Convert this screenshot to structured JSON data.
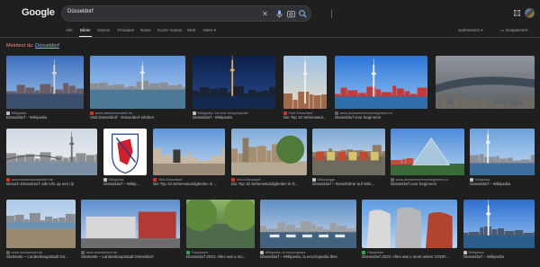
{
  "header": {
    "logo": "Google",
    "query": "Düsseldorf"
  },
  "tabs": [
    {
      "label": "Alle",
      "active": false
    },
    {
      "label": "Bilder",
      "active": true
    },
    {
      "label": "Videos",
      "active": false
    },
    {
      "label": "Produkte",
      "active": false
    },
    {
      "label": "News",
      "active": false
    },
    {
      "label": "Kurze Videos",
      "active": false
    },
    {
      "label": "Web",
      "active": false
    },
    {
      "label": "Mehr",
      "active": false
    }
  ],
  "tools": {
    "safesearch": "SafeSearch",
    "saved": "Gespeichert"
  },
  "suggestion": {
    "prefix": "Meintest du:",
    "term": "Düsseldorf"
  },
  "results": [
    {
      "source": "Wikipedia",
      "title": "Düsseldorf – Wikipedia",
      "scene": "skyline_sunset",
      "fav": "#bdc1c6"
    },
    {
      "source": "www.visitduesseldorf.de",
      "title": "Visit Düsseldorf - Düsseldorf erleben",
      "scene": "skyline_day",
      "fav": "#d93025"
    },
    {
      "source": "Wikipedia, the free encyclopedia",
      "title": "Düsseldorf - Wikipedia",
      "scene": "tower_night",
      "fav": "#bdc1c6"
    },
    {
      "source": "Visit Düsseldorf",
      "title": "Die Top 10 Sehenswür...",
      "scene": "tower_close",
      "fav": "#d93025"
    },
    {
      "source": "www.duesseldorfvoorbeginners.nl",
      "title": "Düsseldorf voor beginners",
      "scene": "skyline_blue",
      "fav": "#5f6368"
    },
    {
      "source": "",
      "title": "",
      "scene": "aerial",
      "fav": "#5f6368"
    },
    {
      "source": "www.beusteduesseldorf.de",
      "title": "Besuch Düsseldorf: alle info op een rij!",
      "scene": "bridge_river",
      "fav": "#d93025"
    },
    {
      "source": "Wikipedia",
      "title": "Düsseldorf – Wikip...",
      "scene": "coat_of_arms",
      "fav": "#bdc1c6"
    },
    {
      "source": "Visit Düsseldorf",
      "title": "Die Top 10 Sehenswürdigkeiten in ...",
      "scene": "statue_square",
      "fav": "#d93025"
    },
    {
      "source": "Visit Düsseldorf",
      "title": "Die Top 10 Sehenswürdigkeiten in D...",
      "scene": "promenade",
      "fav": "#d93025"
    },
    {
      "source": "Wikivoyage",
      "title": "Düsseldorf – Reiseführer auf Wiki...",
      "scene": "market",
      "fav": "#bdc1c6"
    },
    {
      "source": "www.duesseldorfvoorbeginners.nl",
      "title": "Düsseldorf voor beginners",
      "scene": "glass_building",
      "fav": "#5f6368"
    },
    {
      "source": "Wikipedia",
      "title": "Düsseldorf – Wikipedia",
      "scene": "tower_river",
      "fav": "#bdc1c6"
    },
    {
      "source": "www.duesseldorf.de",
      "title": "Startseite – Landeshauptstadt Dü...",
      "scene": "riverside_people",
      "fav": "#5f6368"
    },
    {
      "source": "www.duesseldorf.de",
      "title": "Startseite – Landeshauptstadt Düsseldorf",
      "scene": "modern_block",
      "fav": "#5f6368"
    },
    {
      "source": "Tripadvisor",
      "title": "Düsseldorf 2024: Alles wat u mo...",
      "scene": "canal_trees",
      "fav": "#34a853"
    },
    {
      "source": "Wikipedia, la enciclopedia",
      "title": "Düsseldorf – Wikipedia, la enciclopedia libre",
      "scene": "harbor_boats",
      "fav": "#bdc1c6"
    },
    {
      "source": "Tripadvisor",
      "title": "Düsseldorf 2024: Alles wat u moet weten VOOR...",
      "scene": "gehry",
      "fav": "#34a853"
    },
    {
      "source": "Wikipedia",
      "title": "Düsseldorf – Wikipedia",
      "scene": "tower_blue",
      "fav": "#bdc1c6"
    }
  ]
}
